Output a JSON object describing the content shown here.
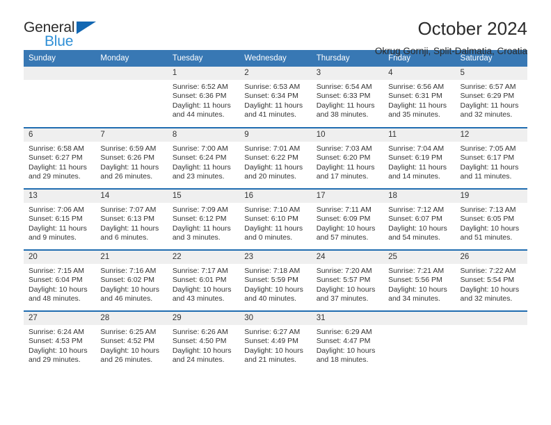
{
  "logo": {
    "word1": "General",
    "word2": "Blue",
    "triangle_color": "#1267b2",
    "word2_color": "#2f8fd6"
  },
  "header": {
    "title": "October 2024",
    "subtitle": "Okrug Gornji, Split-Dalmatia, Croatia"
  },
  "theme": {
    "header_blue": "#3878b4",
    "row_rule_blue": "#1f6cb0",
    "daynum_band": "#efefef"
  },
  "calendar": {
    "weekday_headers": [
      "Sunday",
      "Monday",
      "Tuesday",
      "Wednesday",
      "Thursday",
      "Friday",
      "Saturday"
    ],
    "weeks": [
      [
        {
          "day": "",
          "empty": true
        },
        {
          "day": "",
          "empty": true
        },
        {
          "day": "1",
          "sunrise": "Sunrise: 6:52 AM",
          "sunset": "Sunset: 6:36 PM",
          "daylight1": "Daylight: 11 hours",
          "daylight2": "and 44 minutes."
        },
        {
          "day": "2",
          "sunrise": "Sunrise: 6:53 AM",
          "sunset": "Sunset: 6:34 PM",
          "daylight1": "Daylight: 11 hours",
          "daylight2": "and 41 minutes."
        },
        {
          "day": "3",
          "sunrise": "Sunrise: 6:54 AM",
          "sunset": "Sunset: 6:33 PM",
          "daylight1": "Daylight: 11 hours",
          "daylight2": "and 38 minutes."
        },
        {
          "day": "4",
          "sunrise": "Sunrise: 6:56 AM",
          "sunset": "Sunset: 6:31 PM",
          "daylight1": "Daylight: 11 hours",
          "daylight2": "and 35 minutes."
        },
        {
          "day": "5",
          "sunrise": "Sunrise: 6:57 AM",
          "sunset": "Sunset: 6:29 PM",
          "daylight1": "Daylight: 11 hours",
          "daylight2": "and 32 minutes."
        }
      ],
      [
        {
          "day": "6",
          "sunrise": "Sunrise: 6:58 AM",
          "sunset": "Sunset: 6:27 PM",
          "daylight1": "Daylight: 11 hours",
          "daylight2": "and 29 minutes."
        },
        {
          "day": "7",
          "sunrise": "Sunrise: 6:59 AM",
          "sunset": "Sunset: 6:26 PM",
          "daylight1": "Daylight: 11 hours",
          "daylight2": "and 26 minutes."
        },
        {
          "day": "8",
          "sunrise": "Sunrise: 7:00 AM",
          "sunset": "Sunset: 6:24 PM",
          "daylight1": "Daylight: 11 hours",
          "daylight2": "and 23 minutes."
        },
        {
          "day": "9",
          "sunrise": "Sunrise: 7:01 AM",
          "sunset": "Sunset: 6:22 PM",
          "daylight1": "Daylight: 11 hours",
          "daylight2": "and 20 minutes."
        },
        {
          "day": "10",
          "sunrise": "Sunrise: 7:03 AM",
          "sunset": "Sunset: 6:20 PM",
          "daylight1": "Daylight: 11 hours",
          "daylight2": "and 17 minutes."
        },
        {
          "day": "11",
          "sunrise": "Sunrise: 7:04 AM",
          "sunset": "Sunset: 6:19 PM",
          "daylight1": "Daylight: 11 hours",
          "daylight2": "and 14 minutes."
        },
        {
          "day": "12",
          "sunrise": "Sunrise: 7:05 AM",
          "sunset": "Sunset: 6:17 PM",
          "daylight1": "Daylight: 11 hours",
          "daylight2": "and 11 minutes."
        }
      ],
      [
        {
          "day": "13",
          "sunrise": "Sunrise: 7:06 AM",
          "sunset": "Sunset: 6:15 PM",
          "daylight1": "Daylight: 11 hours",
          "daylight2": "and 9 minutes."
        },
        {
          "day": "14",
          "sunrise": "Sunrise: 7:07 AM",
          "sunset": "Sunset: 6:13 PM",
          "daylight1": "Daylight: 11 hours",
          "daylight2": "and 6 minutes."
        },
        {
          "day": "15",
          "sunrise": "Sunrise: 7:09 AM",
          "sunset": "Sunset: 6:12 PM",
          "daylight1": "Daylight: 11 hours",
          "daylight2": "and 3 minutes."
        },
        {
          "day": "16",
          "sunrise": "Sunrise: 7:10 AM",
          "sunset": "Sunset: 6:10 PM",
          "daylight1": "Daylight: 11 hours",
          "daylight2": "and 0 minutes."
        },
        {
          "day": "17",
          "sunrise": "Sunrise: 7:11 AM",
          "sunset": "Sunset: 6:09 PM",
          "daylight1": "Daylight: 10 hours",
          "daylight2": "and 57 minutes."
        },
        {
          "day": "18",
          "sunrise": "Sunrise: 7:12 AM",
          "sunset": "Sunset: 6:07 PM",
          "daylight1": "Daylight: 10 hours",
          "daylight2": "and 54 minutes."
        },
        {
          "day": "19",
          "sunrise": "Sunrise: 7:13 AM",
          "sunset": "Sunset: 6:05 PM",
          "daylight1": "Daylight: 10 hours",
          "daylight2": "and 51 minutes."
        }
      ],
      [
        {
          "day": "20",
          "sunrise": "Sunrise: 7:15 AM",
          "sunset": "Sunset: 6:04 PM",
          "daylight1": "Daylight: 10 hours",
          "daylight2": "and 48 minutes."
        },
        {
          "day": "21",
          "sunrise": "Sunrise: 7:16 AM",
          "sunset": "Sunset: 6:02 PM",
          "daylight1": "Daylight: 10 hours",
          "daylight2": "and 46 minutes."
        },
        {
          "day": "22",
          "sunrise": "Sunrise: 7:17 AM",
          "sunset": "Sunset: 6:01 PM",
          "daylight1": "Daylight: 10 hours",
          "daylight2": "and 43 minutes."
        },
        {
          "day": "23",
          "sunrise": "Sunrise: 7:18 AM",
          "sunset": "Sunset: 5:59 PM",
          "daylight1": "Daylight: 10 hours",
          "daylight2": "and 40 minutes."
        },
        {
          "day": "24",
          "sunrise": "Sunrise: 7:20 AM",
          "sunset": "Sunset: 5:57 PM",
          "daylight1": "Daylight: 10 hours",
          "daylight2": "and 37 minutes."
        },
        {
          "day": "25",
          "sunrise": "Sunrise: 7:21 AM",
          "sunset": "Sunset: 5:56 PM",
          "daylight1": "Daylight: 10 hours",
          "daylight2": "and 34 minutes."
        },
        {
          "day": "26",
          "sunrise": "Sunrise: 7:22 AM",
          "sunset": "Sunset: 5:54 PM",
          "daylight1": "Daylight: 10 hours",
          "daylight2": "and 32 minutes."
        }
      ],
      [
        {
          "day": "27",
          "sunrise": "Sunrise: 6:24 AM",
          "sunset": "Sunset: 4:53 PM",
          "daylight1": "Daylight: 10 hours",
          "daylight2": "and 29 minutes."
        },
        {
          "day": "28",
          "sunrise": "Sunrise: 6:25 AM",
          "sunset": "Sunset: 4:52 PM",
          "daylight1": "Daylight: 10 hours",
          "daylight2": "and 26 minutes."
        },
        {
          "day": "29",
          "sunrise": "Sunrise: 6:26 AM",
          "sunset": "Sunset: 4:50 PM",
          "daylight1": "Daylight: 10 hours",
          "daylight2": "and 24 minutes."
        },
        {
          "day": "30",
          "sunrise": "Sunrise: 6:27 AM",
          "sunset": "Sunset: 4:49 PM",
          "daylight1": "Daylight: 10 hours",
          "daylight2": "and 21 minutes."
        },
        {
          "day": "31",
          "sunrise": "Sunrise: 6:29 AM",
          "sunset": "Sunset: 4:47 PM",
          "daylight1": "Daylight: 10 hours",
          "daylight2": "and 18 minutes."
        },
        {
          "day": "",
          "empty": true
        },
        {
          "day": "",
          "empty": true
        }
      ]
    ]
  }
}
